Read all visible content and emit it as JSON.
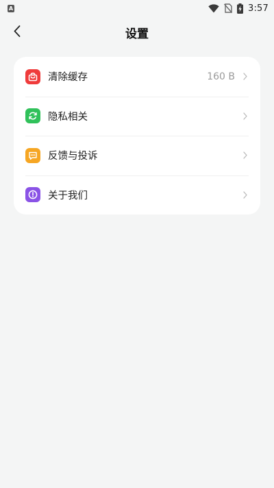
{
  "status_bar": {
    "notification_icon_letter": "A",
    "time": "3:57",
    "icons": [
      "wifi-icon",
      "no-sim-icon",
      "battery-charging-icon"
    ]
  },
  "header": {
    "title": "设置",
    "back_icon": "chevron-left-icon"
  },
  "settings": {
    "items": [
      {
        "label": "清除缓存",
        "value": "160 B",
        "icon": "shopping-bag-icon",
        "color": "#ef3b3b"
      },
      {
        "label": "隐私相关",
        "value": "",
        "icon": "refresh-icon",
        "color": "#30c15a"
      },
      {
        "label": "反馈与投诉",
        "value": "",
        "icon": "chat-bubble-icon",
        "color": "#f6a623"
      },
      {
        "label": "关于我们",
        "value": "",
        "icon": "info-icon",
        "color": "#8a53e6"
      }
    ]
  },
  "colors": {
    "background": "#f4f5f5",
    "card": "#ffffff",
    "chevron": "#b9b9b9"
  }
}
